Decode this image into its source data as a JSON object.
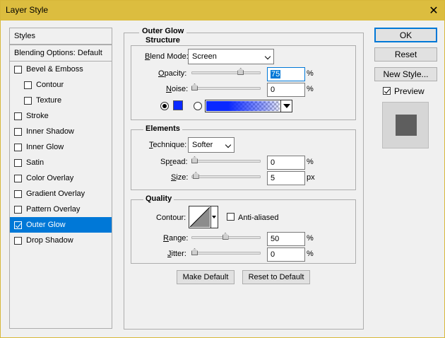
{
  "window": {
    "title": "Layer Style"
  },
  "sidebar": {
    "header": "Styles",
    "blending": "Blending Options: Default",
    "items": [
      {
        "label": "Bevel & Emboss",
        "checked": false,
        "indent": false
      },
      {
        "label": "Contour",
        "checked": false,
        "indent": true
      },
      {
        "label": "Texture",
        "checked": false,
        "indent": true
      },
      {
        "label": "Stroke",
        "checked": false,
        "indent": false
      },
      {
        "label": "Inner Shadow",
        "checked": false,
        "indent": false
      },
      {
        "label": "Inner Glow",
        "checked": false,
        "indent": false
      },
      {
        "label": "Satin",
        "checked": false,
        "indent": false
      },
      {
        "label": "Color Overlay",
        "checked": false,
        "indent": false
      },
      {
        "label": "Gradient Overlay",
        "checked": false,
        "indent": false
      },
      {
        "label": "Pattern Overlay",
        "checked": false,
        "indent": false
      },
      {
        "label": "Outer Glow",
        "checked": true,
        "indent": false,
        "selected": true
      },
      {
        "label": "Drop Shadow",
        "checked": false,
        "indent": false
      }
    ]
  },
  "panel": {
    "title": "Outer Glow",
    "structure": {
      "title": "Structure",
      "blend_mode_label_pre": "",
      "blend_mode_label_u": "B",
      "blend_mode_label_post": "lend Mode:",
      "blend_mode_value": "Screen",
      "opacity_label_u": "O",
      "opacity_label_post": "pacity:",
      "opacity_value": "75",
      "opacity_fraction": 0.75,
      "noise_label_u": "N",
      "noise_label_post": "oise:",
      "noise_value": "0",
      "noise_fraction": 0,
      "percent": "%",
      "color_hex": "#0a28ff"
    },
    "elements": {
      "title": "Elements",
      "technique_label_u": "T",
      "technique_label_post": "echnique:",
      "technique_value": "Softer",
      "spread_label_pre": "Sp",
      "spread_label_u": "r",
      "spread_label_post": "ead:",
      "spread_value": "0",
      "spread_fraction": 0,
      "size_label_u": "S",
      "size_label_post": "ize:",
      "size_value": "5",
      "size_fraction": 0.02,
      "percent": "%",
      "px": "px"
    },
    "quality": {
      "title": "Quality",
      "contour_label": "Contour:",
      "anti_aliased_label": "Anti-aliased",
      "anti_aliased_checked": false,
      "range_label_u": "R",
      "range_label_post": "ange:",
      "range_value": "50",
      "range_fraction": 0.5,
      "jitter_label_u": "J",
      "jitter_label_post": "itter:",
      "jitter_value": "0",
      "jitter_fraction": 0,
      "percent": "%"
    },
    "make_default": "Make Default",
    "reset_default": "Reset to Default"
  },
  "actions": {
    "ok": "OK",
    "reset": "Reset",
    "new_style": "New Style...",
    "preview": "Preview",
    "preview_checked": true
  }
}
